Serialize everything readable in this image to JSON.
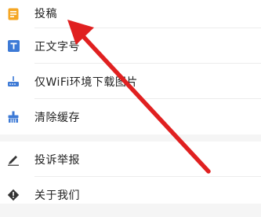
{
  "menu": {
    "group1": [
      {
        "label": "投稿",
        "icon": "document-icon"
      },
      {
        "label": "正文字号",
        "icon": "text-size-icon"
      },
      {
        "label": "仅WiFi环境下载图片",
        "icon": "wifi-router-icon"
      },
      {
        "label": "清除缓存",
        "icon": "broom-icon"
      }
    ],
    "group2": [
      {
        "label": "投诉举报",
        "icon": "pen-icon"
      },
      {
        "label": "关于我们",
        "icon": "warning-icon"
      }
    ]
  },
  "colors": {
    "arrow": "#e02020",
    "document_icon": "#f5a623",
    "text_size_icon": "#3d7ad6",
    "wifi_icon": "#3d7ad6",
    "broom_icon": "#3d7ad6",
    "dark_icon": "#333333"
  }
}
